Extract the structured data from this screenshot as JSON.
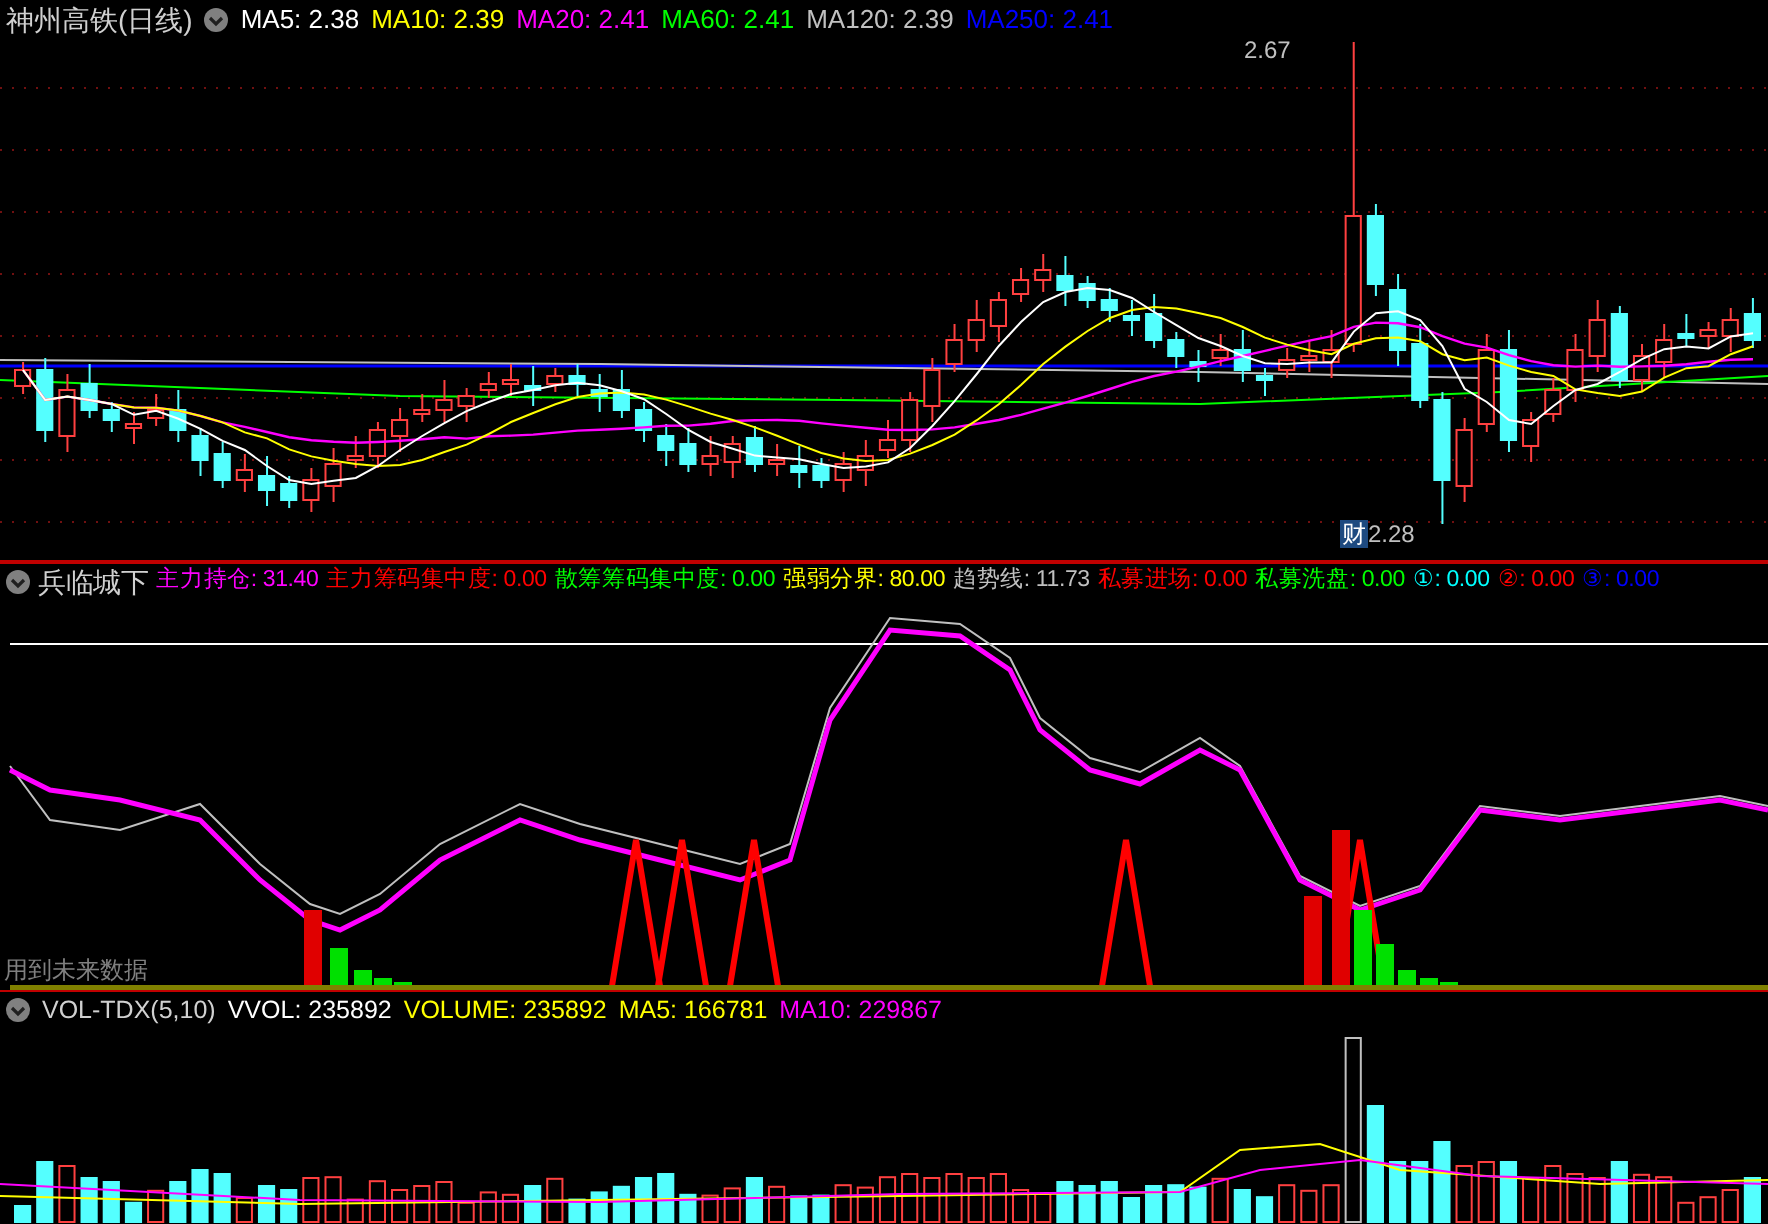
{
  "main_panel": {
    "title": "神州高铁(日线)",
    "indicators": [
      {
        "label": "MA5: 2.38",
        "color": "#ffffff"
      },
      {
        "label": "MA10: 2.39",
        "color": "#ffff00"
      },
      {
        "label": "MA20: 2.41",
        "color": "#ff00ff"
      },
      {
        "label": "MA60: 2.41",
        "color": "#00ff00"
      },
      {
        "label": "MA120: 2.39",
        "color": "#c0c0c0"
      },
      {
        "label": "MA250: 2.41",
        "color": "#0000ff"
      }
    ],
    "high_label": "2.67",
    "low_label": "2.28",
    "marker": "财"
  },
  "indicator_panel": {
    "title": "兵临城下",
    "values": [
      {
        "label": "主力持仓: 31.40",
        "color": "#ff00ff"
      },
      {
        "label": "主力筹码集中度: 0.00",
        "color": "#ff0000"
      },
      {
        "label": "散筹筹码集中度: 0.00",
        "color": "#00ff00"
      },
      {
        "label": "强弱分界: 80.00",
        "color": "#ffff00"
      },
      {
        "label": "趋势线: 11.73",
        "color": "#c0c0c0"
      },
      {
        "label": "私募进场: 0.00",
        "color": "#ff0000"
      },
      {
        "label": "私募洗盘: 0.00",
        "color": "#00ff00"
      },
      {
        "label": "①: 0.00",
        "color": "#00ffff"
      },
      {
        "label": "②: 0.00",
        "color": "#ff0000"
      },
      {
        "label": "③: 0.00",
        "color": "#0000ff"
      }
    ],
    "note": "用到未来数据"
  },
  "volume_panel": {
    "title": "VOL-TDX(5,10)",
    "values": [
      {
        "label": "VVOL: 235892",
        "color": "#ffffff"
      },
      {
        "label": "VOLUME: 235892",
        "color": "#ffff00"
      },
      {
        "label": "MA5: 166781",
        "color": "#ffff00"
      },
      {
        "label": "MA10: 229867",
        "color": "#ff00ff"
      }
    ]
  }
}
